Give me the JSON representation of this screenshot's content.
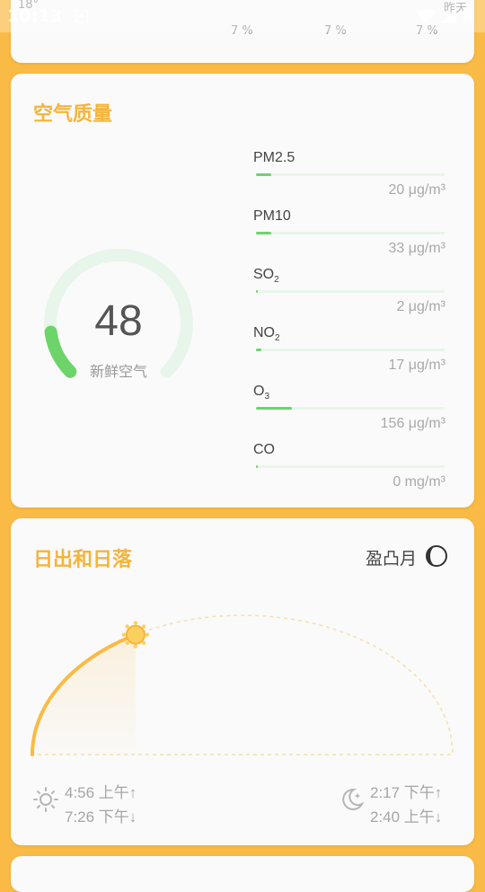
{
  "status_bar": {
    "time": "10:13",
    "notification_icon": "A"
  },
  "top_card": {
    "temperature": "18°",
    "label_right": "昨天",
    "percentages": [
      "7 %",
      "7 %",
      "7 %"
    ]
  },
  "air_quality": {
    "title": "空气质量",
    "aqi": "48",
    "aqi_label": "新鲜空气",
    "aqi_fraction": 0.14,
    "pollutants": [
      {
        "name": "PM2.5",
        "sub": "",
        "value": "20 μg/m³",
        "fraction": 0.08
      },
      {
        "name": "PM10",
        "sub": "",
        "value": "33 μg/m³",
        "fraction": 0.08
      },
      {
        "name": "SO",
        "sub": "2",
        "value": "2 μg/m³",
        "fraction": 0.01
      },
      {
        "name": "NO",
        "sub": "2",
        "value": "17 μg/m³",
        "fraction": 0.03
      },
      {
        "name": "O",
        "sub": "3",
        "value": "156 μg/m³",
        "fraction": 0.19
      },
      {
        "name": "CO",
        "sub": "",
        "value": "0 mg/m³",
        "fraction": 0.01
      }
    ],
    "colors": {
      "accent": "#6dd46a",
      "track": "#e8f5ea"
    }
  },
  "sun_moon": {
    "title": "日出和日落",
    "moon_phase": "盈凸月",
    "sunrise": "4:56 上午↑",
    "sunset": "7:26 下午↓",
    "moonrise": "2:17 下午↑",
    "moonset": "2:40 上午↓",
    "sun_progress": 0.33,
    "accent_color": "#f9bb45"
  }
}
